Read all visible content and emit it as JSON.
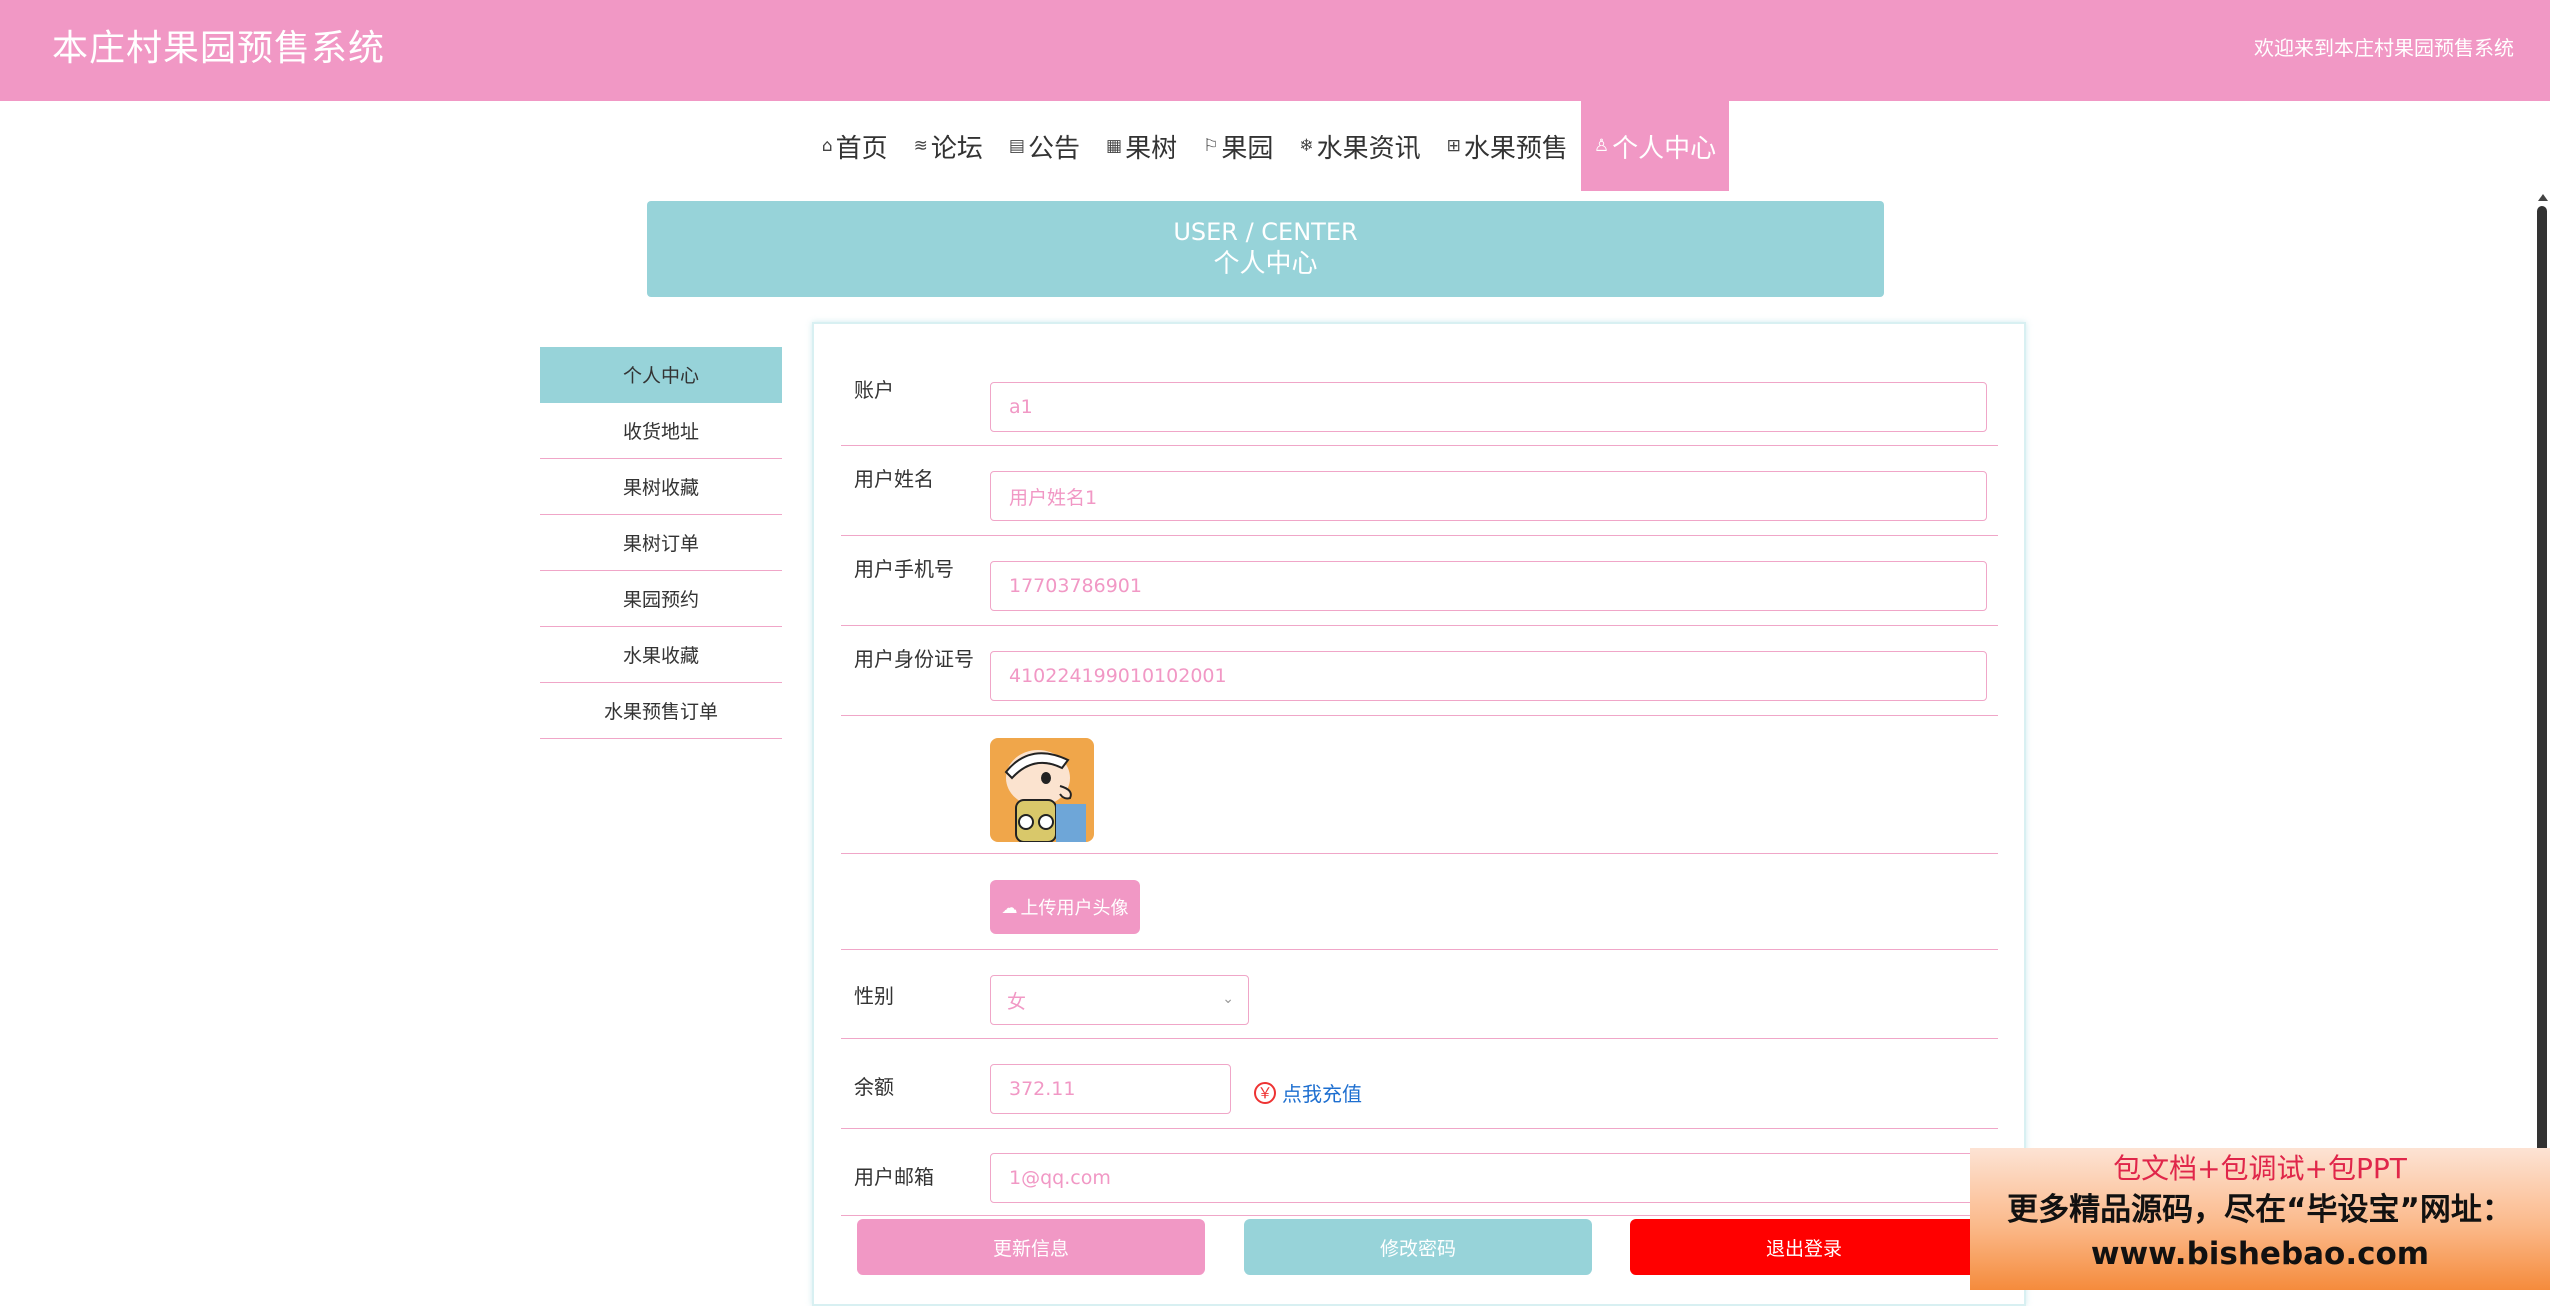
{
  "header": {
    "title": "本庄村果园预售系统",
    "welcome": "欢迎来到本庄村果园预售系统",
    "bg_color": "#f198c5"
  },
  "nav": [
    {
      "label": "首页",
      "icon": "⌂",
      "icon_name": "home-icon",
      "active": false
    },
    {
      "label": "论坛",
      "icon": "≋",
      "icon_name": "layers-icon",
      "active": false
    },
    {
      "label": "公告",
      "icon": "▤",
      "icon_name": "notice-icon",
      "active": false
    },
    {
      "label": "果树",
      "icon": "▦",
      "icon_name": "grid-icon",
      "active": false
    },
    {
      "label": "果园",
      "icon": "⚐",
      "icon_name": "flag-icon",
      "active": false
    },
    {
      "label": "水果资讯",
      "icon": "❄",
      "icon_name": "snowflake-icon",
      "active": false
    },
    {
      "label": "水果预售",
      "icon": "⊞",
      "icon_name": "apps-icon",
      "active": false
    },
    {
      "label": "个人中心",
      "icon": "♙",
      "icon_name": "user-icon",
      "active": true
    }
  ],
  "banner": {
    "en": "USER / CENTER",
    "cn": "个人中心",
    "bg_color": "#97d3d9"
  },
  "sidebar": [
    {
      "label": "个人中心",
      "active": true
    },
    {
      "label": "收货地址",
      "active": false
    },
    {
      "label": "果树收藏",
      "active": false
    },
    {
      "label": "果树订单",
      "active": false
    },
    {
      "label": "果园预约",
      "active": false
    },
    {
      "label": "水果收藏",
      "active": false
    },
    {
      "label": "水果预售订单",
      "active": false
    }
  ],
  "form": {
    "account": {
      "label": "账户",
      "value": "a1"
    },
    "name": {
      "label": "用户姓名",
      "value": "用户姓名1"
    },
    "phone": {
      "label": "用户手机号",
      "value": "17703786901"
    },
    "idcard": {
      "label": "用户身份证号",
      "value": "410224199010102001"
    },
    "avatar": {
      "label": ""
    },
    "upload": {
      "label": "上传用户头像",
      "icon": "cloud-upload-icon"
    },
    "gender": {
      "label": "性别",
      "value": "女"
    },
    "balance": {
      "label": "余额",
      "value": "372.11",
      "recharge": "点我充值",
      "recharge_icon": "￥"
    },
    "email": {
      "label": "用户邮箱",
      "value": "1@qq.com"
    }
  },
  "buttons": {
    "update": {
      "label": "更新信息",
      "color": "#f198c5"
    },
    "password": {
      "label": "修改密码",
      "color": "#97d3d9"
    },
    "logout": {
      "label": "退出登录",
      "color": "#ff0000"
    }
  },
  "ad": {
    "line1": "包文档+包调试+包PPT",
    "line2": "更多精品源码，尽在“毕设宝”网址：",
    "line3": "www.bishebao.com"
  }
}
